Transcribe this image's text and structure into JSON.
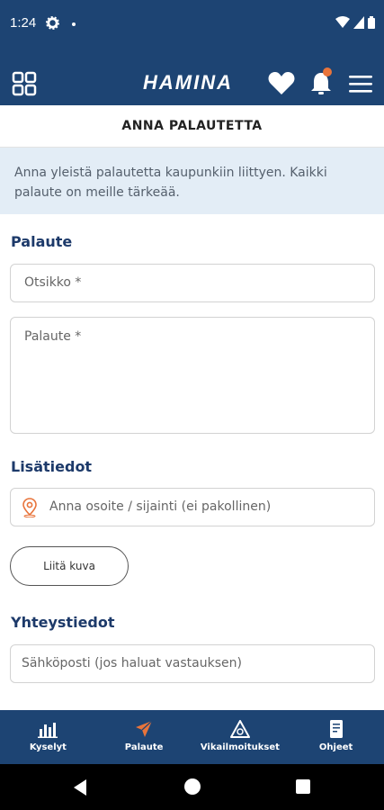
{
  "status": {
    "time": "1:24"
  },
  "app": {
    "logo_text": "HAMINA"
  },
  "page": {
    "title": "ANNA PALAUTETTA",
    "info": "Anna yleistä palautetta kaupunkiin liittyen. Kaikki palaute on meille tärkeää."
  },
  "form": {
    "section_feedback": "Palaute",
    "title_placeholder": "Otsikko *",
    "feedback_placeholder": "Palaute *",
    "section_extra": "Lisätiedot",
    "location_placeholder": "Anna osoite / sijainti (ei pakollinen)",
    "attach_label": "Liitä kuva",
    "section_contact": "Yhteystiedot",
    "email_placeholder": "Sähköposti (jos haluat vastauksen)"
  },
  "bottom_nav": [
    {
      "label": "Kyselyt",
      "icon": "bar-chart-icon"
    },
    {
      "label": "Palaute",
      "icon": "paper-plane-icon"
    },
    {
      "label": "Vikailmoitukset",
      "icon": "warning-icon"
    },
    {
      "label": "Ohjeet",
      "icon": "document-icon"
    }
  ],
  "colors": {
    "primary": "#1d4473",
    "accent": "#e8743b",
    "info_bg": "#e3edf6",
    "section_title": "#1d3a6a"
  }
}
